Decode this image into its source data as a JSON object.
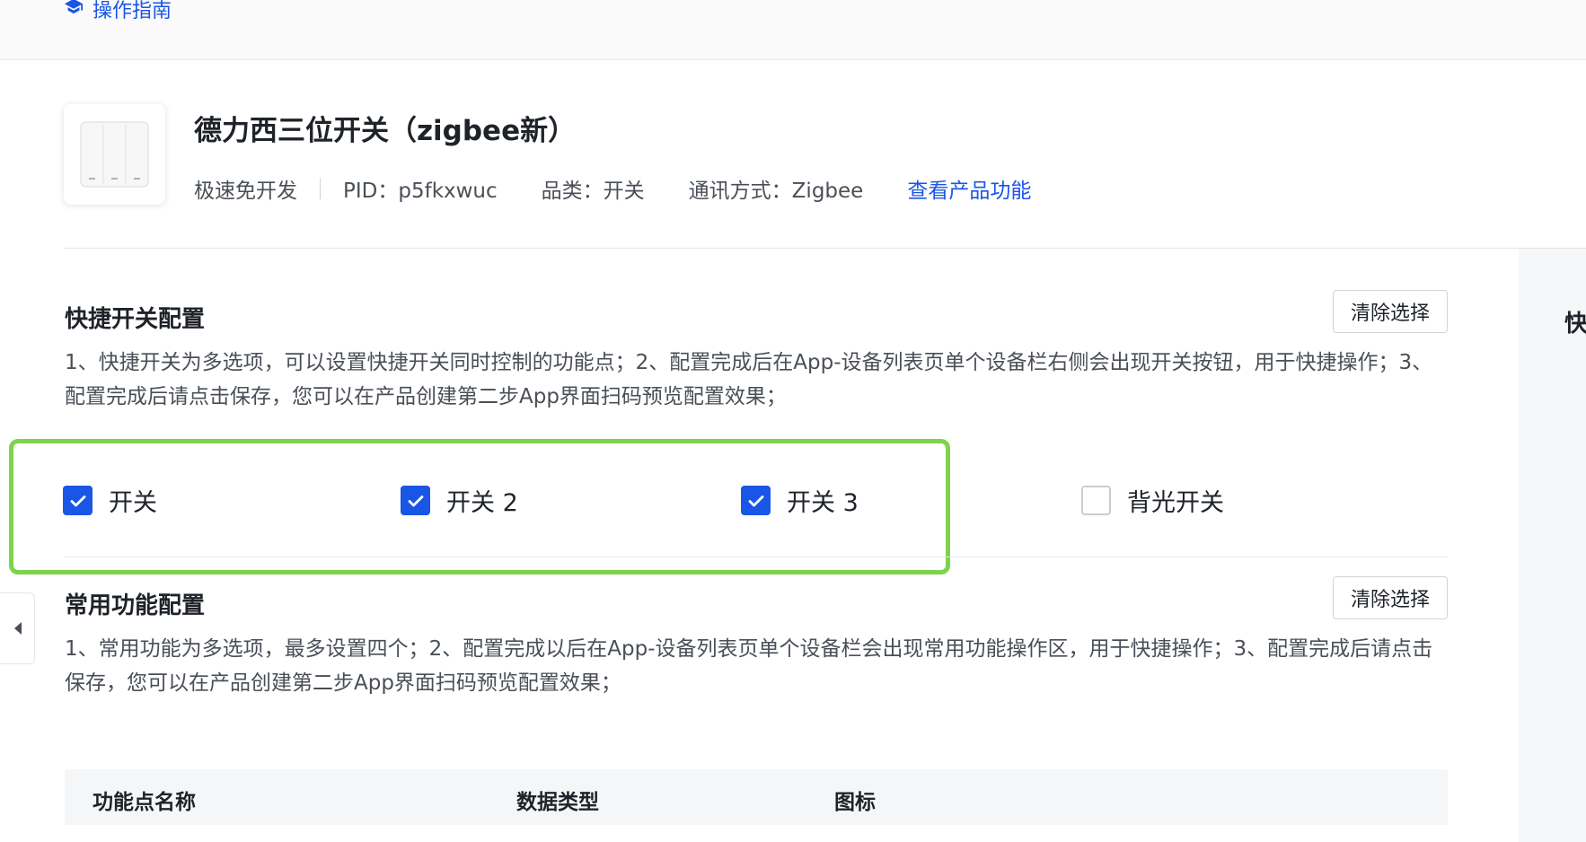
{
  "header": {
    "guide_label": "操作指南"
  },
  "product": {
    "name": "德力西三位开关（zigbee新）",
    "dev_mode": "极速免开发",
    "pid": "PID：p5fkxwuc",
    "category": "品类：开关",
    "protocol": "通讯方式：Zigbee",
    "view_features_link": "查看产品功能"
  },
  "quick_switch": {
    "title": "快捷开关配置",
    "clear_label": "清除选择",
    "description": "1、快捷开关为多选项，可以设置快捷开关同时控制的功能点；2、配置完成后在App-设备列表页单个设备栏右侧会出现开关按钮，用于快捷操作；3、配置完成后请点击保存，您可以在产品创建第二步App界面扫码预览配置效果；",
    "options": [
      {
        "label": "开关",
        "checked": true
      },
      {
        "label": "开关 2",
        "checked": true
      },
      {
        "label": "开关 3",
        "checked": true
      },
      {
        "label": "背光开关",
        "checked": false
      }
    ]
  },
  "common_functions": {
    "title": "常用功能配置",
    "clear_label": "清除选择",
    "description": "1、常用功能为多选项，最多设置四个；2、配置完成以后在App-设备列表页单个设备栏会出现常用功能操作区，用于快捷操作；3、配置完成后请点击保存，您可以在产品创建第二步App界面扫码预览配置效果；",
    "table_headers": [
      "功能点名称",
      "数据类型",
      "图标"
    ]
  },
  "right_panel": {
    "title_fragment": "快"
  },
  "colors": {
    "accent": "#1a56e6",
    "highlight": "#7ed34a"
  }
}
